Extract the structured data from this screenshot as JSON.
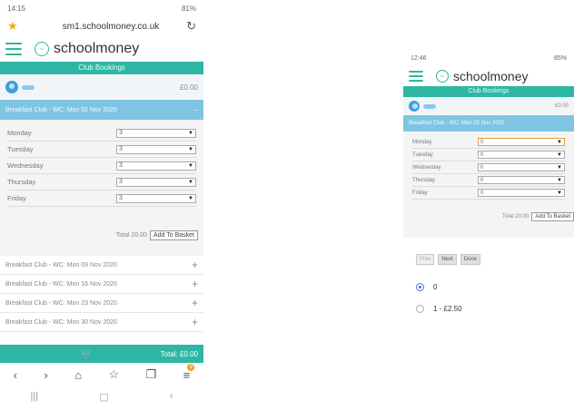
{
  "colors": {
    "brand": "#2eb7a2",
    "selected_week": "#7fc5e3",
    "avatar": "#3aa0e0"
  },
  "left": {
    "status_time": "14:15",
    "status_right": "81%",
    "url": "sm1.schoolmoney.co.uk",
    "logo_text": "schoolmoney",
    "section_title": "Club Bookings",
    "balance": "£0.00",
    "selected_week": "Breakfast Club - WC: Mon 02 Nov 2020",
    "collapse_symbol": "–",
    "days": [
      {
        "label": "Monday",
        "value": "3"
      },
      {
        "label": "Tuesday",
        "value": "3"
      },
      {
        "label": "Wednesday",
        "value": "3"
      },
      {
        "label": "Thursday",
        "value": "3"
      },
      {
        "label": "Friday",
        "value": "3"
      }
    ],
    "total_text": "Total 20.00",
    "add_button": "Add To Basket",
    "other_weeks": [
      "Breakfast Club - WC: Mon 09 Nov 2020",
      "Breakfast Club - WC: Mon 16 Nov 2020",
      "Breakfast Club - WC: Mon 23 Nov 2020",
      "Breakfast Club - WC: Mon 30 Nov 2020"
    ],
    "footer_total": "Total: £0.00"
  },
  "right": {
    "status_time": "12:46",
    "status_right": "85%",
    "logo_text": "schoolmoney",
    "section_title": "Club Bookings",
    "balance": "£0.00",
    "selected_week": "Breakfast Club - WC: Mon 02 Nov 2020",
    "days": [
      {
        "label": "Monday",
        "value": "0"
      },
      {
        "label": "Tuesday",
        "value": "0"
      },
      {
        "label": "Wednesday",
        "value": "0"
      },
      {
        "label": "Thursday",
        "value": "0"
      },
      {
        "label": "Friday",
        "value": "0"
      }
    ],
    "total_text": "Total 20.00",
    "add_button": "Add To Basket",
    "picker_buttons": [
      "Prev",
      "Next",
      "Done"
    ],
    "options": [
      {
        "label": "0",
        "selected": true
      },
      {
        "label": "1 - £2.50",
        "selected": false
      }
    ]
  }
}
